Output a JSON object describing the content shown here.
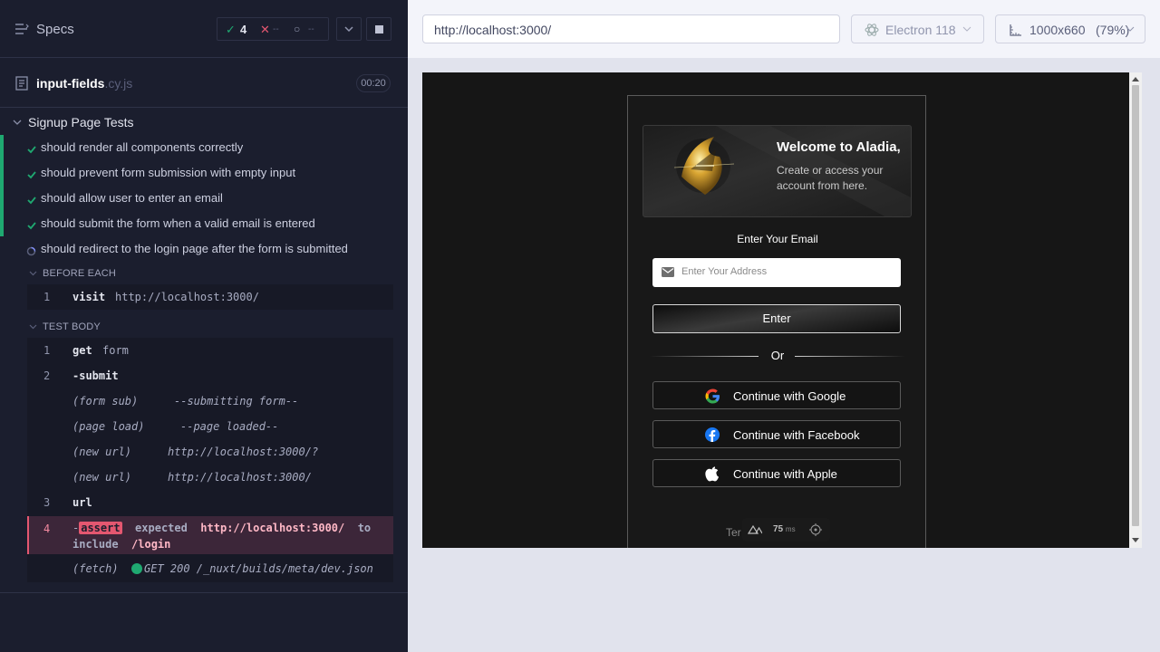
{
  "sidebar": {
    "specs_label": "Specs",
    "stats": {
      "passed": "4",
      "failed": "--",
      "pending": "--"
    },
    "file": {
      "name": "input-fields",
      "ext": ".cy.js",
      "duration": "00:20"
    },
    "suite": "Signup Page Tests",
    "tests": [
      {
        "label": "should render all components correctly",
        "state": "passed"
      },
      {
        "label": "should prevent form submission with empty input",
        "state": "passed"
      },
      {
        "label": "should allow user to enter an email",
        "state": "passed"
      },
      {
        "label": "should submit the form when a valid email is entered",
        "state": "passed"
      },
      {
        "label": "should redirect to the login page after the form is submitted",
        "state": "running"
      }
    ],
    "before_each": {
      "header": "BEFORE EACH",
      "commands": [
        {
          "num": "1",
          "name": "visit",
          "msg": "http://localhost:3000/"
        }
      ]
    },
    "test_body": {
      "header": "TEST BODY",
      "commands": [
        {
          "num": "1",
          "name": "get",
          "msg": "form"
        },
        {
          "num": "2",
          "name": "-submit",
          "msg": ""
        },
        {
          "num": "",
          "name": "(form sub)",
          "msg": "--submitting form--"
        },
        {
          "num": "",
          "name": "(page load)",
          "msg": "--page loaded--"
        },
        {
          "num": "",
          "name": "(new url)",
          "msg": "http://localhost:3000/?"
        },
        {
          "num": "",
          "name": "(new url)",
          "msg": "http://localhost:3000/"
        },
        {
          "num": "3",
          "name": "url",
          "msg": ""
        }
      ],
      "assert": {
        "num": "4",
        "prefix": "-",
        "name": "assert",
        "expected": "expected",
        "value": "http://localhost:3000/",
        "to": "to",
        "include": "include",
        "target": "/login"
      },
      "fetch": {
        "name": "(fetch)",
        "msg": "GET 200 /_nuxt/builds/meta/dev.json"
      }
    }
  },
  "browser_bar": {
    "url": "http://localhost:3000/",
    "browser": "Electron 118",
    "viewport": "1000x660",
    "zoom": "(79%)"
  },
  "app": {
    "hero_title": "Welcome to Aladia,",
    "hero_subtitle": "Create or access your account from here.",
    "email_label": "Enter Your Email",
    "email_placeholder": "Enter Your Address",
    "enter_button": "Enter",
    "or_text": "Or",
    "google": "Continue with Google",
    "facebook": "Continue with Facebook",
    "apple": "Continue with Apple",
    "footer_partial": "Ter",
    "devtools_ms": "75",
    "devtools_unit": "ms"
  },
  "colors": {
    "passed": "#1fa971",
    "failed": "#e45770",
    "panel": "#1b1e2e"
  }
}
